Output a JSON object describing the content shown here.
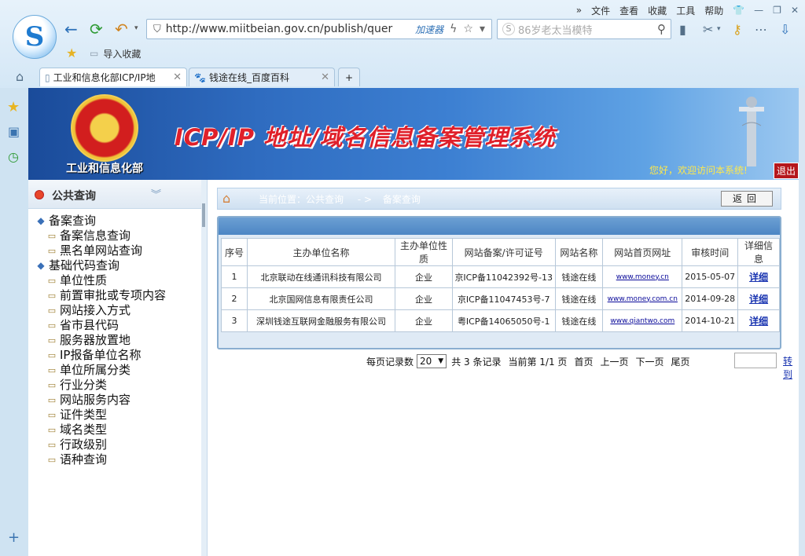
{
  "browser": {
    "menu": [
      "»",
      "文件",
      "查看",
      "收藏",
      "工具",
      "帮助"
    ],
    "address": "http://www.miitbeian.gov.cn/publish/quer",
    "accelerator": "加速器",
    "search_placeholder": "86岁老太当模特",
    "favbar_item": "导入收藏",
    "tabs": [
      {
        "label": "工业和信息化部ICP/IP地"
      },
      {
        "label": "钱途在线_百度百科"
      }
    ],
    "new_tab": "+"
  },
  "site": {
    "ministry": "工业和信息化部",
    "system_title": "ICP/IP 地址/域名信息备案管理系统",
    "welcome": "您好，欢迎访问本系统!",
    "logout": "退出"
  },
  "nav": {
    "title": "公共查询",
    "items": [
      {
        "label": "备案查询",
        "level": 0
      },
      {
        "label": "备案信息查询",
        "level": 1
      },
      {
        "label": "黑名单网站查询",
        "level": 1
      },
      {
        "label": "基础代码查询",
        "level": 0
      },
      {
        "label": "单位性质",
        "level": 1
      },
      {
        "label": "前置审批或专项内容",
        "level": 1
      },
      {
        "label": "网站接入方式",
        "level": 1
      },
      {
        "label": "省市县代码",
        "level": 1
      },
      {
        "label": "服务器放置地",
        "level": 1
      },
      {
        "label": "IP报备单位名称",
        "level": 1
      },
      {
        "label": "单位所属分类",
        "level": 1
      },
      {
        "label": "行业分类",
        "level": 1
      },
      {
        "label": "网站服务内容",
        "level": 1
      },
      {
        "label": "证件类型",
        "level": 1
      },
      {
        "label": "域名类型",
        "level": 1
      },
      {
        "label": "行政级别",
        "level": 1
      },
      {
        "label": "语种查询",
        "level": 1
      }
    ]
  },
  "breadcrumb": {
    "prefix": "当前位置：公共查询",
    "arrow": "- >",
    "current": "备案查询",
    "back": "返回"
  },
  "table": {
    "headers": [
      "序号",
      "主办单位名称",
      "主办单位性质",
      "网站备案/许可证号",
      "网站名称",
      "网站首页网址",
      "审核时间",
      "详细信息"
    ],
    "rows": [
      [
        "1",
        "北京联动在线通讯科技有限公司",
        "企业",
        "京ICP备11042392号-13",
        "钱途在线",
        "www.money.cn",
        "2015-05-07",
        "详细"
      ],
      [
        "2",
        "北京国网信息有限责任公司",
        "企业",
        "京ICP备11047453号-7",
        "钱途在线",
        "www.money.com.cn",
        "2014-09-28",
        "详细"
      ],
      [
        "3",
        "深圳钱途互联网金融服务有限公司",
        "企业",
        "粤ICP备14065050号-1",
        "钱途在线",
        "www.qiantwo.com",
        "2014-10-21",
        "详细"
      ]
    ]
  },
  "pager": {
    "per_page_label": "每页记录数",
    "per_page": "20",
    "total": "共 3 条记录",
    "current": "当前第 1/1 页",
    "first": "首页",
    "prev": "上一页",
    "next": "下一页",
    "last": "尾页",
    "jump": "转到"
  }
}
